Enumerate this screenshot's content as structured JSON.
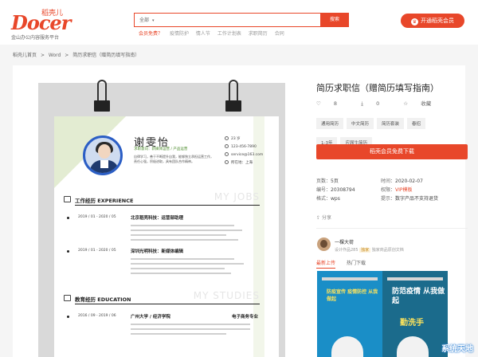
{
  "header": {
    "logo": {
      "cn": "稻壳儿",
      "en": "Docer",
      "slogan": "金山办公内容服务平台"
    },
    "search": {
      "category": "全部",
      "button": "搜索",
      "placeholder": ""
    },
    "quick_links": [
      {
        "label": "会员免费？",
        "hot": true
      },
      {
        "label": "疫情防护",
        "hot": false
      },
      {
        "label": "情人节",
        "hot": false
      },
      {
        "label": "工作计划表",
        "hot": false
      },
      {
        "label": "求职简历",
        "hot": false
      },
      {
        "label": "合同",
        "hot": false
      }
    ],
    "vip_button": "开通稻壳会员",
    "accent": "#e8472a"
  },
  "breadcrumb": [
    "稻壳儿首页",
    ">",
    "Word",
    ">",
    "简历求职信（赠简历填写指南）"
  ],
  "resume": {
    "name": "谢雯怡",
    "sub": "求职意向：新媒体运营 / 产品运营",
    "bio": "自律学习，善于不断提升自我，能够独立承担运营工作，责任心强，积极进取，具有团队合作精神。",
    "info": [
      "23 岁",
      "123-456-7890",
      "service@163.com",
      "所在地：上海"
    ],
    "sections": [
      {
        "title": "工作经历  EXPERIENCE",
        "watermark": "MY JOBS"
      },
      {
        "title": "教育经历  EDUCATION",
        "watermark": "MY STUDIES"
      }
    ],
    "jobs": [
      {
        "date": "2019 / 01 - 2020 / 05",
        "company": "北京稻壳科技：运营部助理"
      },
      {
        "date": "2019 / 01 - 2020 / 05",
        "company": "深圳光明科技：新媒体编辑"
      }
    ],
    "edu": {
      "date": "2016 / 09 - 2019 / 06",
      "school": "广州大学  /  经济学院",
      "major": "电子商务专业"
    }
  },
  "detail": {
    "title": "简历求职信（赠简历填写指南）",
    "likes": "8",
    "downloads": "0",
    "collect": "收藏",
    "tags": [
      "通用简历",
      "中文简历",
      "简历套装",
      "春招",
      "1-3年",
      "应届生简历"
    ],
    "download_button": "稻壳会员免费下载",
    "meta": {
      "pages_label": "页数：",
      "pages": "5页",
      "time_label": "时间：",
      "time": "2020-02-07",
      "id_label": "编号：",
      "id": "20308794",
      "priv_label": "权限：",
      "priv": "VIP模板",
      "format_label": "格式：",
      "format": "wps",
      "note_label": "提示：",
      "note": "数字产品不支持退货"
    },
    "share": "分享",
    "author": {
      "name": "一棵大荷",
      "desc_pre": "设计作品285",
      "badge": "独家",
      "desc_post": "独家商品原创文档"
    },
    "tabs": [
      {
        "label": "最新上传",
        "active": true
      },
      {
        "label": "热门下载",
        "active": false
      }
    ],
    "cards": [
      {
        "headline": "防疫宣传 疫情防控 从我做起"
      },
      {
        "headline": "防范疫情 从我做起",
        "sub": "勤洗手"
      }
    ]
  },
  "watermark": "系统天地"
}
